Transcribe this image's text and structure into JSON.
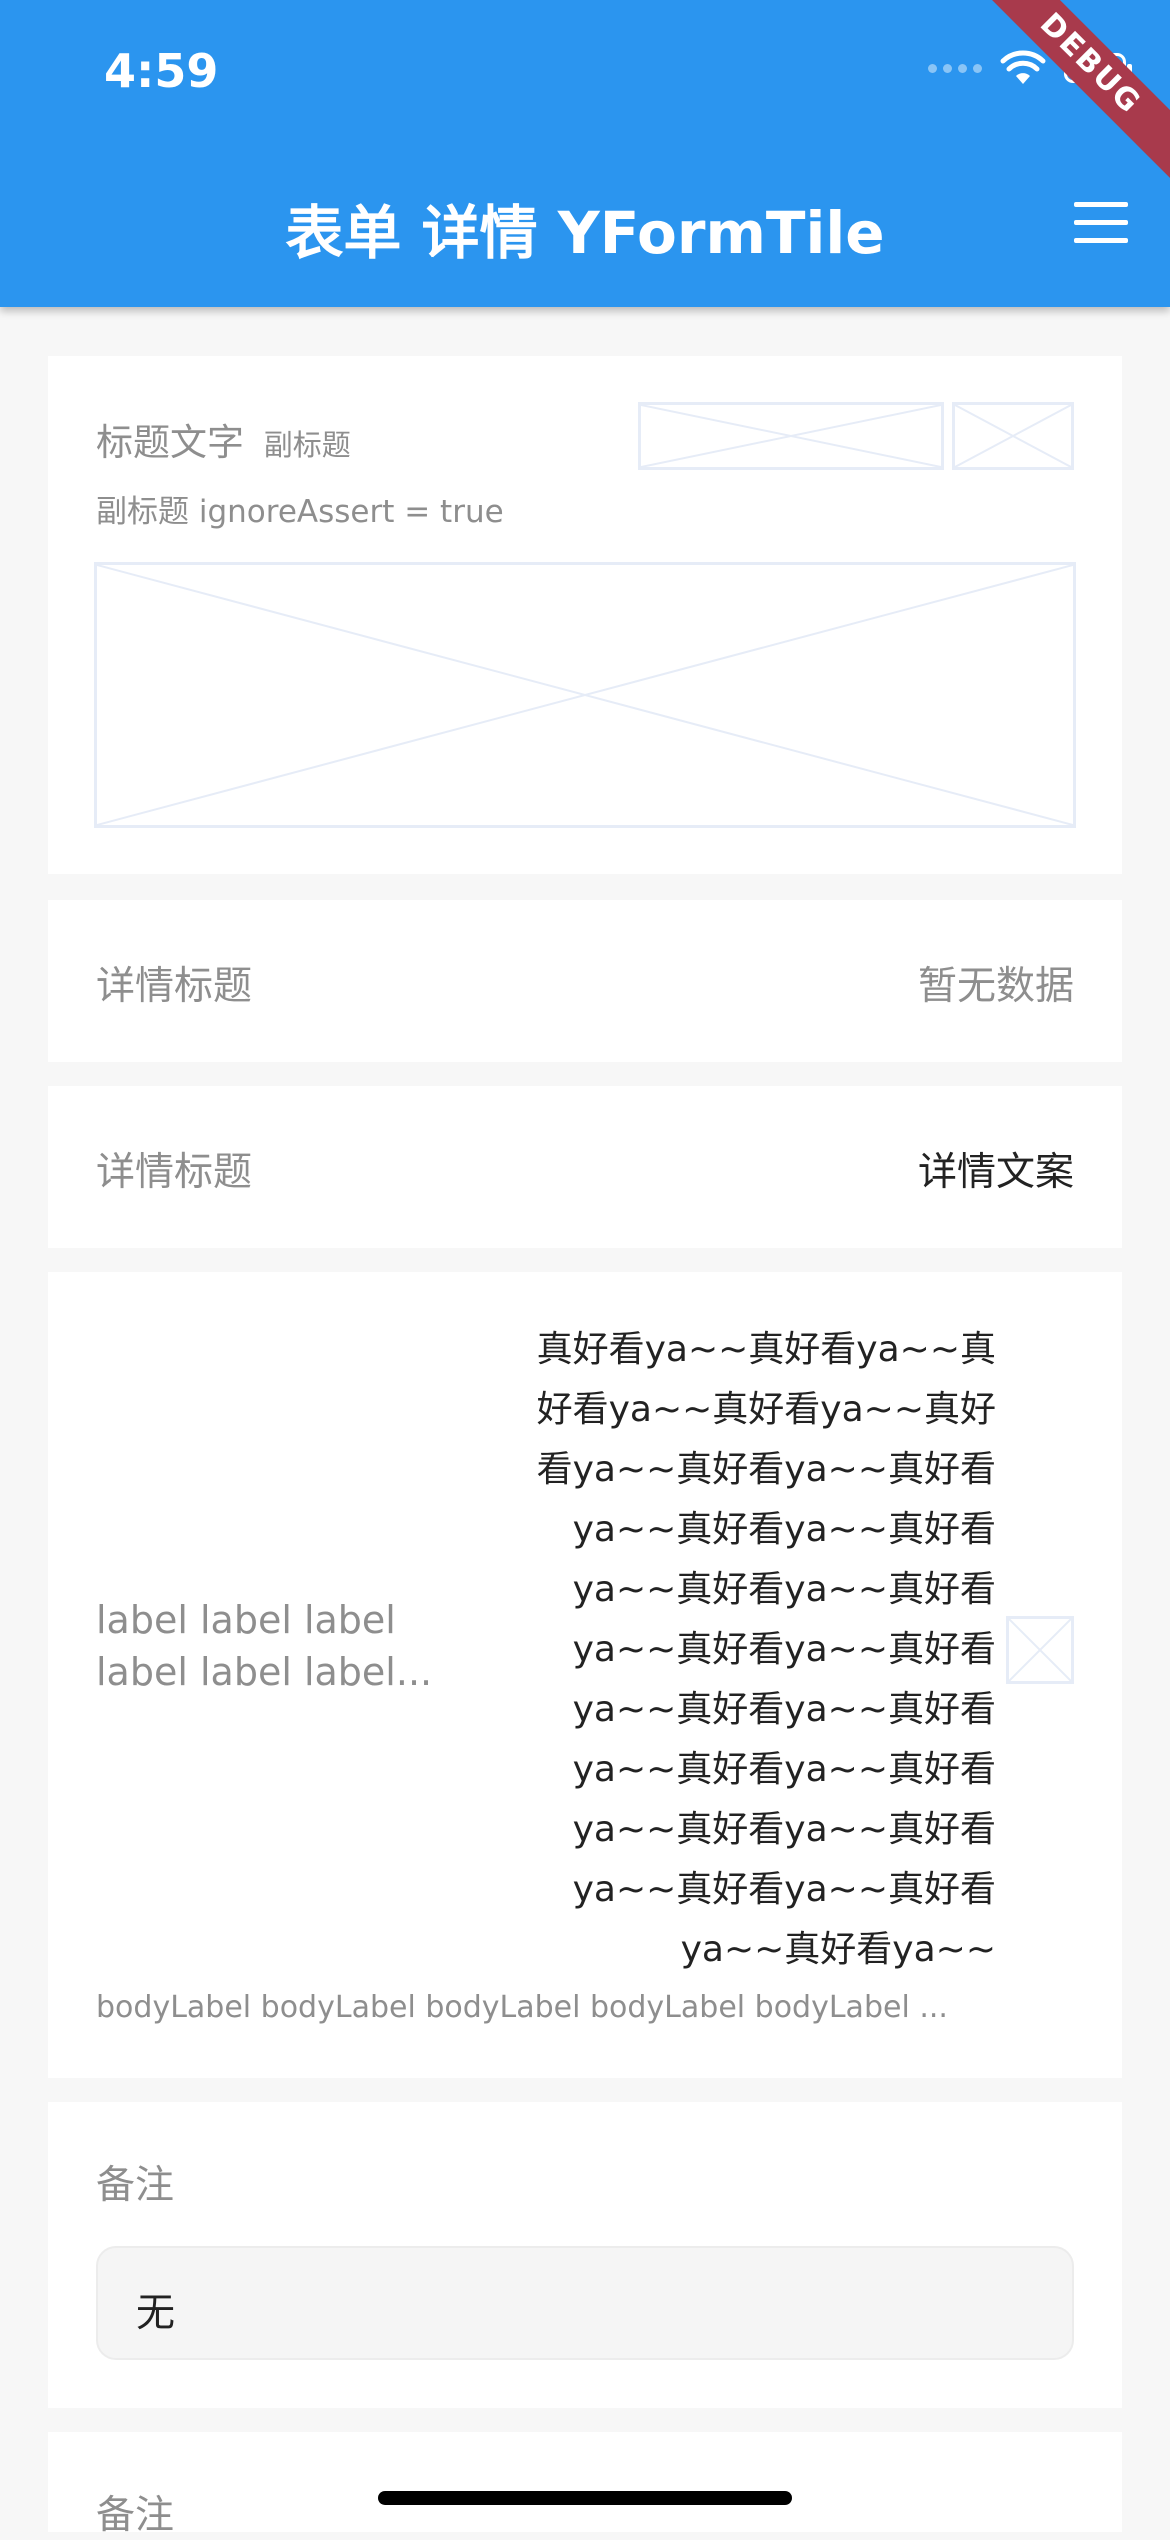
{
  "status_bar": {
    "time": "4:59"
  },
  "debug_banner": "DEBUG",
  "app_bar": {
    "title": "表单 详情 YFormTile",
    "menu_icon": "menu-icon"
  },
  "card1": {
    "title": "标题文字",
    "subtitle_inline": "副标题",
    "subtitle": "副标题 ignoreAssert = true"
  },
  "detail_empty": {
    "label": "详情标题",
    "value": "暂无数据"
  },
  "detail_filled": {
    "label": "详情标题",
    "value": "详情文案"
  },
  "long_item": {
    "label_lines": [
      "label label label",
      "label label label..."
    ],
    "value_lines": [
      "真好看ya~~真好看ya~~真",
      "好看ya~~真好看ya~~真好",
      "看ya~~真好看ya~~真好看",
      "ya~~真好看ya~~真好看",
      "ya~~真好看ya~~真好看",
      "ya~~真好看ya~~真好看",
      "ya~~真好看ya~~真好看",
      "ya~~真好看ya~~真好看",
      "ya~~真好看ya~~真好看",
      "ya~~真好看ya~~真好看",
      "ya~~真好看ya~~"
    ],
    "body_label": "bodyLabel bodyLabel bodyLabel bodyLabel bodyLabel ..."
  },
  "remark1": {
    "label": "备注",
    "value": "无"
  },
  "remark2": {
    "label": "备注"
  },
  "colors": {
    "primary": "#2b95ef",
    "muted": "#8e8e8e",
    "placeholder": "#e6ecf7"
  }
}
